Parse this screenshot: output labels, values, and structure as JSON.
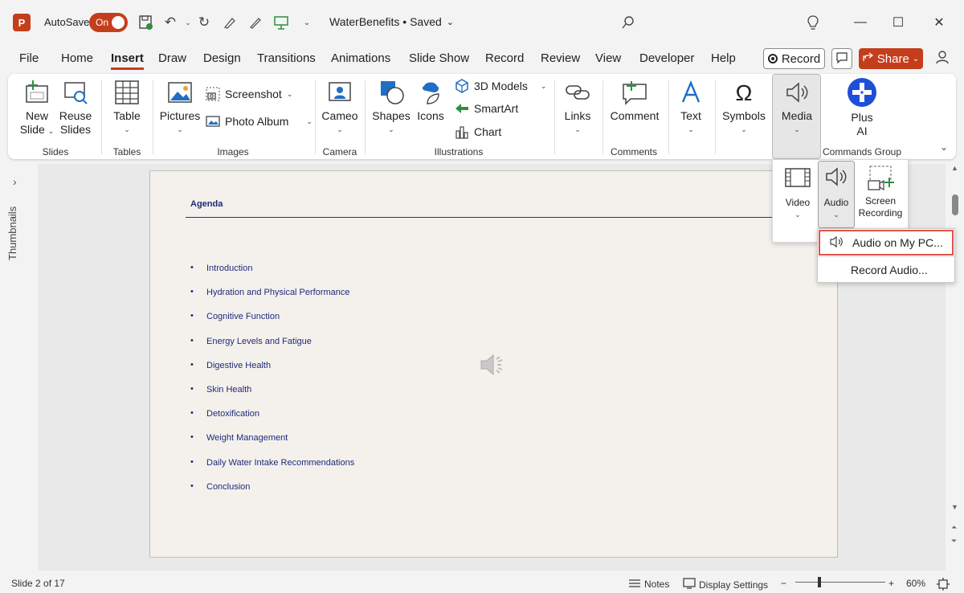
{
  "titlebar": {
    "app_icon_letter": "P",
    "autosave_label": "AutoSave",
    "autosave_state": "On",
    "document_title": "WaterBenefits • Saved",
    "icons": [
      "save-icon",
      "undo-icon",
      "redo-icon",
      "highlighter-icon",
      "pen-icon",
      "present-icon",
      "customize-icon",
      "search-icon",
      "lightbulb-icon",
      "minimize-icon",
      "maximize-icon",
      "close-icon"
    ]
  },
  "tabs": [
    "File",
    "Home",
    "Insert",
    "Draw",
    "Design",
    "Transitions",
    "Animations",
    "Slide Show",
    "Record",
    "Review",
    "View",
    "Developer",
    "Help"
  ],
  "active_tab": "Insert",
  "header_actions": {
    "record_label": "Record",
    "share_label": "Share"
  },
  "ribbon": {
    "new_slide": "New Slide",
    "new_slide_l1": "New",
    "new_slide_l2": "Slide",
    "reuse_l1": "Reuse",
    "reuse_l2": "Slides",
    "table": "Table",
    "pictures": "Pictures",
    "screenshot": "Screenshot",
    "photo_album": "Photo Album",
    "cameo": "Cameo",
    "shapes": "Shapes",
    "icons": "Icons",
    "models_3d": "3D Models",
    "smartart": "SmartArt",
    "chart": "Chart",
    "links": "Links",
    "comment": "Comment",
    "text": "Text",
    "symbols": "Symbols",
    "media": "Media",
    "plus_ai_l1": "Plus",
    "plus_ai_l2": "AI",
    "groups": {
      "slides": "Slides",
      "tables": "Tables",
      "images": "Images",
      "camera": "Camera",
      "illustrations": "Illustrations",
      "comments": "Comments",
      "commands": "Commands Group"
    },
    "accent_color": "#c43e1c"
  },
  "thumbnails_label": "Thumbnails",
  "slide": {
    "title": "Agenda",
    "bullets": [
      "Introduction",
      "Hydration and Physical Performance",
      "Cognitive Function",
      "Energy Levels and Fatigue",
      "Digestive Health",
      "Skin Health",
      "Detoxification",
      "Weight Management",
      "Daily Water Intake Recommendations",
      "Conclusion"
    ],
    "text_color": "#1e2a78"
  },
  "media_panel": {
    "video": "Video",
    "audio": "Audio",
    "screen_recording_l1": "Screen",
    "screen_recording_l2": "Recording"
  },
  "audio_menu": {
    "audio_on_pc": "Audio on My PC...",
    "record_audio": "Record Audio..."
  },
  "statusbar": {
    "slide_info": "Slide 2 of 17",
    "notes": "Notes",
    "display_settings": "Display Settings",
    "zoom_minus": "−",
    "zoom_plus": "+",
    "zoom_level": "60%",
    "zoom_fraction": 0.27
  }
}
